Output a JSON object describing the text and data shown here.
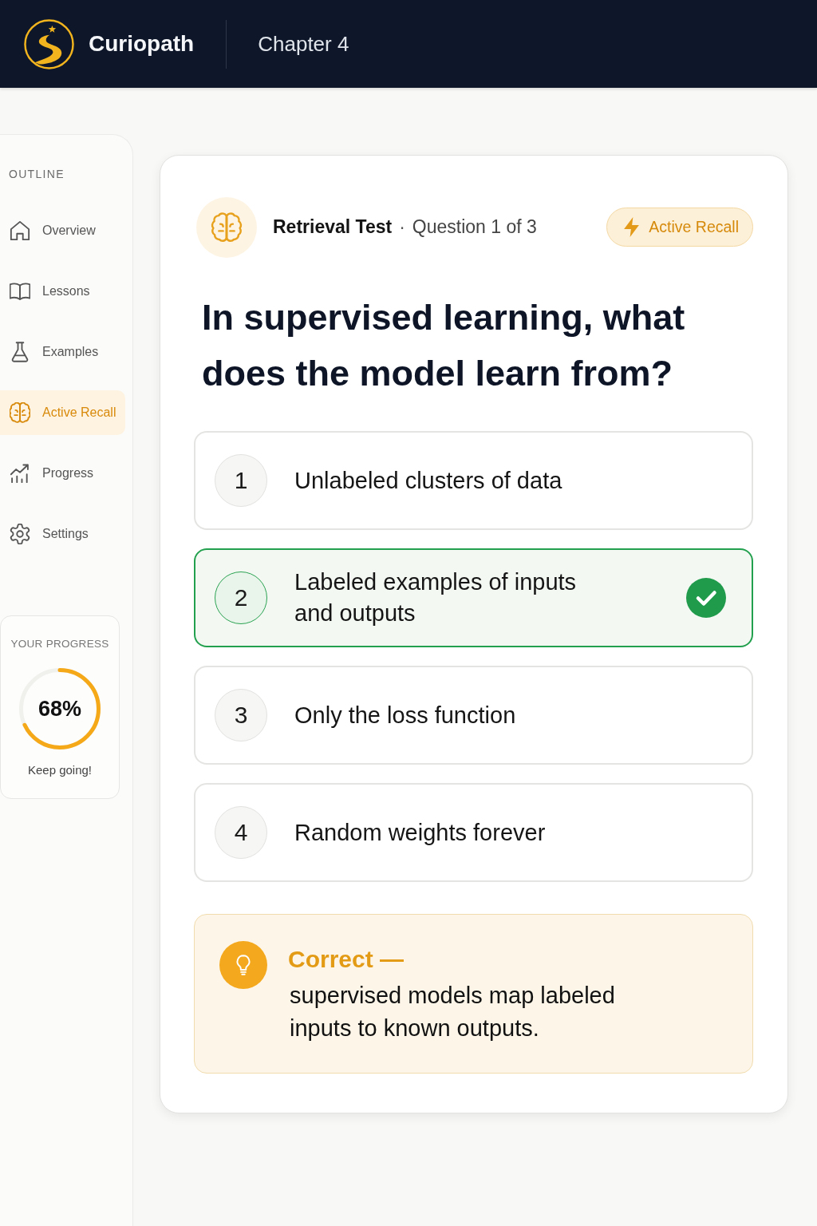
{
  "top_bar": {
    "brand": "Curiopath",
    "chapter": "Chapter 4"
  },
  "sidebar": {
    "heading": "OUTLINE",
    "items": [
      {
        "label": "Overview",
        "selected": false
      },
      {
        "label": "Lessons",
        "selected": false
      },
      {
        "label": "Examples",
        "selected": false
      },
      {
        "label": "Active Recall",
        "selected": true
      },
      {
        "label": "Progress",
        "selected": false
      },
      {
        "label": "Settings",
        "selected": false
      }
    ]
  },
  "progress": {
    "title": "YOUR PROGRESS",
    "level": 0.68,
    "reading": "68%",
    "caption": "Keep going!"
  },
  "quiz": {
    "title": "Retrieval Test",
    "separator": "·",
    "counter": "Question 1 of 3",
    "badge": "Active Recall",
    "question": "In supervised learning, what does the model learn from?",
    "options": [
      {
        "number": "1",
        "text": "Unlabeled clusters of data",
        "selected": false
      },
      {
        "number": "2",
        "text": "Labeled examples of inputs and outputs",
        "selected": true
      },
      {
        "number": "3",
        "text": "Only the loss function",
        "selected": false
      },
      {
        "number": "4",
        "text": "Random weights forever",
        "selected": false
      }
    ],
    "feedback": {
      "title": "Correct —",
      "text": "supervised models map labeled inputs to known outputs."
    }
  }
}
